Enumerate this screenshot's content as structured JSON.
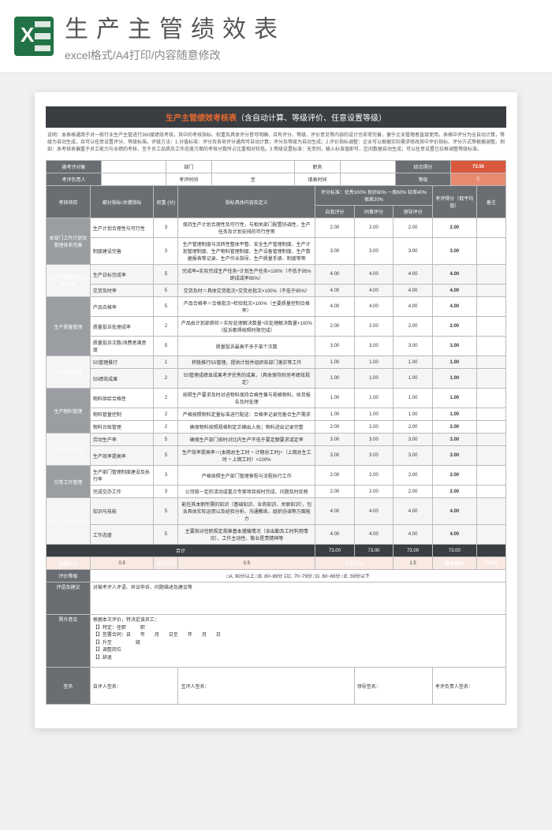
{
  "banner": {
    "title": "生产主管绩效表",
    "sub": "excel格式/A4打印/内容随意修改"
  },
  "sheet_title_orange": "生产主管绩效考核表",
  "sheet_title_rest": "（含自动计算、等级评价、任意设置等级）",
  "intro": "说明：本表格通用于对一般行业生产主管进行360度绩效考核，其中的考核指标、权重及具体评分皆可明确、且有评分、等级、评价意见等内容的设计也非常完善，便于企业管理者直接使用。表格中评分为全自动计算，等级为自动生成，且可以任意设置评分、等级标准。评级方法：1.分值标准：评分及各项评分通用可自动计算；评分及等级为自动生成；2.评价指标调整：企业可以根据实际需求修改其中评价指标、评分方式等根据调整。例如：本考核表偏重于员工能力与业绩的考核，至于员工品质及工作态度方面的考核分数所占比重相对较低。3.等级设置标准：无变则，输入标准值即可，区间数据自动生成；可以任意设置已拉框调整等级标准。",
  "header_rows": {
    "r1": {
      "a": "被考评对象",
      "b": "部门",
      "c": "职务",
      "d": "综合得分",
      "score": "73.50"
    },
    "r2": {
      "a": "考评负责人",
      "b": "考评时间",
      "bv": "至",
      "c": "填表时间",
      "d": "等级",
      "grade": "C"
    }
  },
  "col_headers": {
    "item": "考核项目",
    "sub": "细分指标/关键指标",
    "weight": "权重\n(分)",
    "def": "指标具体内容及定义",
    "scale": "评分标准：优秀100%  良好80%  一般60%  较差40%  很差20%",
    "self": "自我评分",
    "peer": "同事评分",
    "mgr": "领导评分",
    "avg": "考评得分（取平均值）",
    "note": "备注"
  },
  "groups": [
    {
      "name": "本部门工作计划及管理体系完善",
      "rows": [
        {
          "sub": "生产计划合理性与可行性",
          "w": "3",
          "def": "保持生产计划合理性及可行性，与相关部门配置协调性，生产任务及计划安排的可行性等",
          "s": [
            "2.00",
            "2.00",
            "2.00",
            "2.00"
          ]
        },
        {
          "sub": "制度建设完善",
          "w": "3",
          "def": "生产管理制度与流转性整体平整、安全生产管理制度、生产计划管理制度、生产物料管理制度、生产设备管理制度、生产数据报表等记录、生产作业指导、生产质量手册、制度等等",
          "s": [
            "3.00",
            "3.00",
            "3.00",
            "3.00"
          ]
        }
      ]
    },
    {
      "name": "生产计划实施与进度控制",
      "rows": [
        {
          "sub": "生产日标完成率",
          "w": "5",
          "def": "完成率=实际完成生产任务÷计划生产任务×100%（不低于95%即成或率95%）",
          "s": [
            "4.00",
            "4.00",
            "4.00",
            "4.00"
          ]
        },
        {
          "sub": "交货及时率",
          "w": "5",
          "def": "交货及时＝具体交货批次÷交货总批次×100%（不低于95%）",
          "s": [
            "4.00",
            "4.00",
            "4.00",
            "4.00"
          ]
        }
      ]
    },
    {
      "name": "生产质量管理",
      "rows": [
        {
          "sub": "产品合格率",
          "w": "5",
          "def": "产品合格率＝合格批次÷检验批次×100%（主要质量控制合格率）",
          "s": [
            "4.00",
            "4.00",
            "4.00",
            "4.00"
          ]
        },
        {
          "sub": "质量投诉处理成率",
          "w": "2",
          "def": "产品由计划部质检＝实际处理解决数量÷应处理解决数量×100%（投诉都得按照时限完成）",
          "s": [
            "2.00",
            "2.00",
            "2.00",
            "2.00"
          ]
        },
        {
          "sub": "质量投诉次数/消费者满意度",
          "w": "5",
          "def": "质量投诉最高不多于某个次数",
          "s": [
            "3.00",
            "3.00",
            "3.00",
            "3.00"
          ]
        }
      ]
    },
    {
      "name": "生产现场管理",
      "rows": [
        {
          "sub": "5S管理推行",
          "w": "1",
          "def": "积极推行5S管理，提供计划并组织各部门落实等工作",
          "s": [
            "1.00",
            "1.00",
            "1.00",
            "1.00"
          ]
        },
        {
          "sub": "5S绩效成果",
          "w": "2",
          "def": "5S管理成绩显成果考评优秀的成果，（具体保持则须考绩效规定）",
          "s": [
            "1.00",
            "1.00",
            "1.00",
            "1.00"
          ]
        }
      ]
    },
    {
      "name": "生产物料管理",
      "rows": [
        {
          "sub": "物料供给合格性",
          "w": "2",
          "def": "按照生产要求及时对进物料保持合格性兼与规格物料，收货报告及时处理",
          "s": [
            "1.00",
            "1.00",
            "1.00",
            "1.00"
          ]
        },
        {
          "sub": "物料管量控制",
          "w": "2",
          "def": "严格按照物料定量标准进行配送：合格率记录完备合生产需求",
          "s": [
            "1.00",
            "1.00",
            "1.00",
            "1.00"
          ]
        },
        {
          "sub": "物料台账管理",
          "w": "2",
          "def": "确保物料按照规格制定正确出入账；物料进出记录完整",
          "s": [
            "2.00",
            "2.00",
            "2.00",
            "2.00"
          ]
        }
      ]
    },
    {
      "name": "生产效率提高",
      "rows": [
        {
          "sub": "劳动生产率",
          "w": "5",
          "def": "确保生产部门按时对比内生产不低于要定额要求或定率",
          "s": [
            "3.00",
            "3.00",
            "3.00",
            "3.00"
          ]
        },
        {
          "sub": "生产效率提高率",
          "w": "5",
          "def": "生产效率提高率＝(本期总生工时 ÷ 计期总工时)÷（上期总生工时 ÷ 上期工时）×100%",
          "s": [
            "3.00",
            "3.00",
            "3.00",
            "3.00"
          ]
        }
      ]
    },
    {
      "name": "日常工作管理",
      "rows": [
        {
          "sub": "生产部门管理制度建设及执行率",
          "w": "3",
          "def": "严格按照生产部门管理章程与流程执行工作",
          "s": [
            "2.00",
            "2.00",
            "2.00",
            "2.00"
          ]
        },
        {
          "sub": "完成交办工作",
          "w": "3",
          "def": "公司取一定的活动或重点专案项目按时完成、问题及时反映",
          "s": [
            "2.00",
            "2.00",
            "2.00",
            "2.00"
          ]
        }
      ]
    },
    {
      "name": "知识、技能与态度",
      "rows": [
        {
          "sub": "知识与技能",
          "w": "5",
          "def": "能任其本职所需的知识（基础知识、业务知识、关联知识），包含具体实际运用以及经验分析、沟通教练、组织协调等方面能力",
          "s": [
            "4.00",
            "4.00",
            "4.00",
            "4.00"
          ]
        },
        {
          "sub": "工作态度",
          "w": "5",
          "def": "主要指对任职规定规章基本遵循情况（含出勤及工时利用情况）、工作主动性、敬业是责精神等",
          "s": [
            "4.00",
            "4.00",
            "4.00",
            "4.00"
          ]
        }
      ]
    }
  ],
  "totals": {
    "label": "合计",
    "vals": [
      "73.00",
      "73.00",
      "73.00",
      "73.00"
    ]
  },
  "penalty": {
    "a": "出勤扣分",
    "av": "0.5",
    "b": "奖罚扣分",
    "bv": "0.5",
    "c": "奖励加分",
    "cv": "1.5",
    "d": "综合得分",
    "dv": "73.50"
  },
  "grade_row": {
    "label": "评价等级",
    "opts": "□A. 90分以上  □B. 80~89分  ☑C. 70~79分  □D. 60~69分  □E. 59分以下"
  },
  "comment": {
    "label": "评语及建议",
    "hint": "对被考评人评语、异议申诉、问题描述及建议等"
  },
  "decision": {
    "label": "晋升意见",
    "body": "根据本次评价，特决定该员工：\n【】特定：任职　　　职\n【】签署合同：自　　年　　月　　日至　　年　　月　　日\n【】升至　　　　　级\n【】调整岗位\n【】辞退"
  },
  "sign": {
    "label": "签名",
    "a": "自评人签名：",
    "b": "互评人签名：",
    "c": "领导签名：",
    "d": "考评负责人签名："
  }
}
